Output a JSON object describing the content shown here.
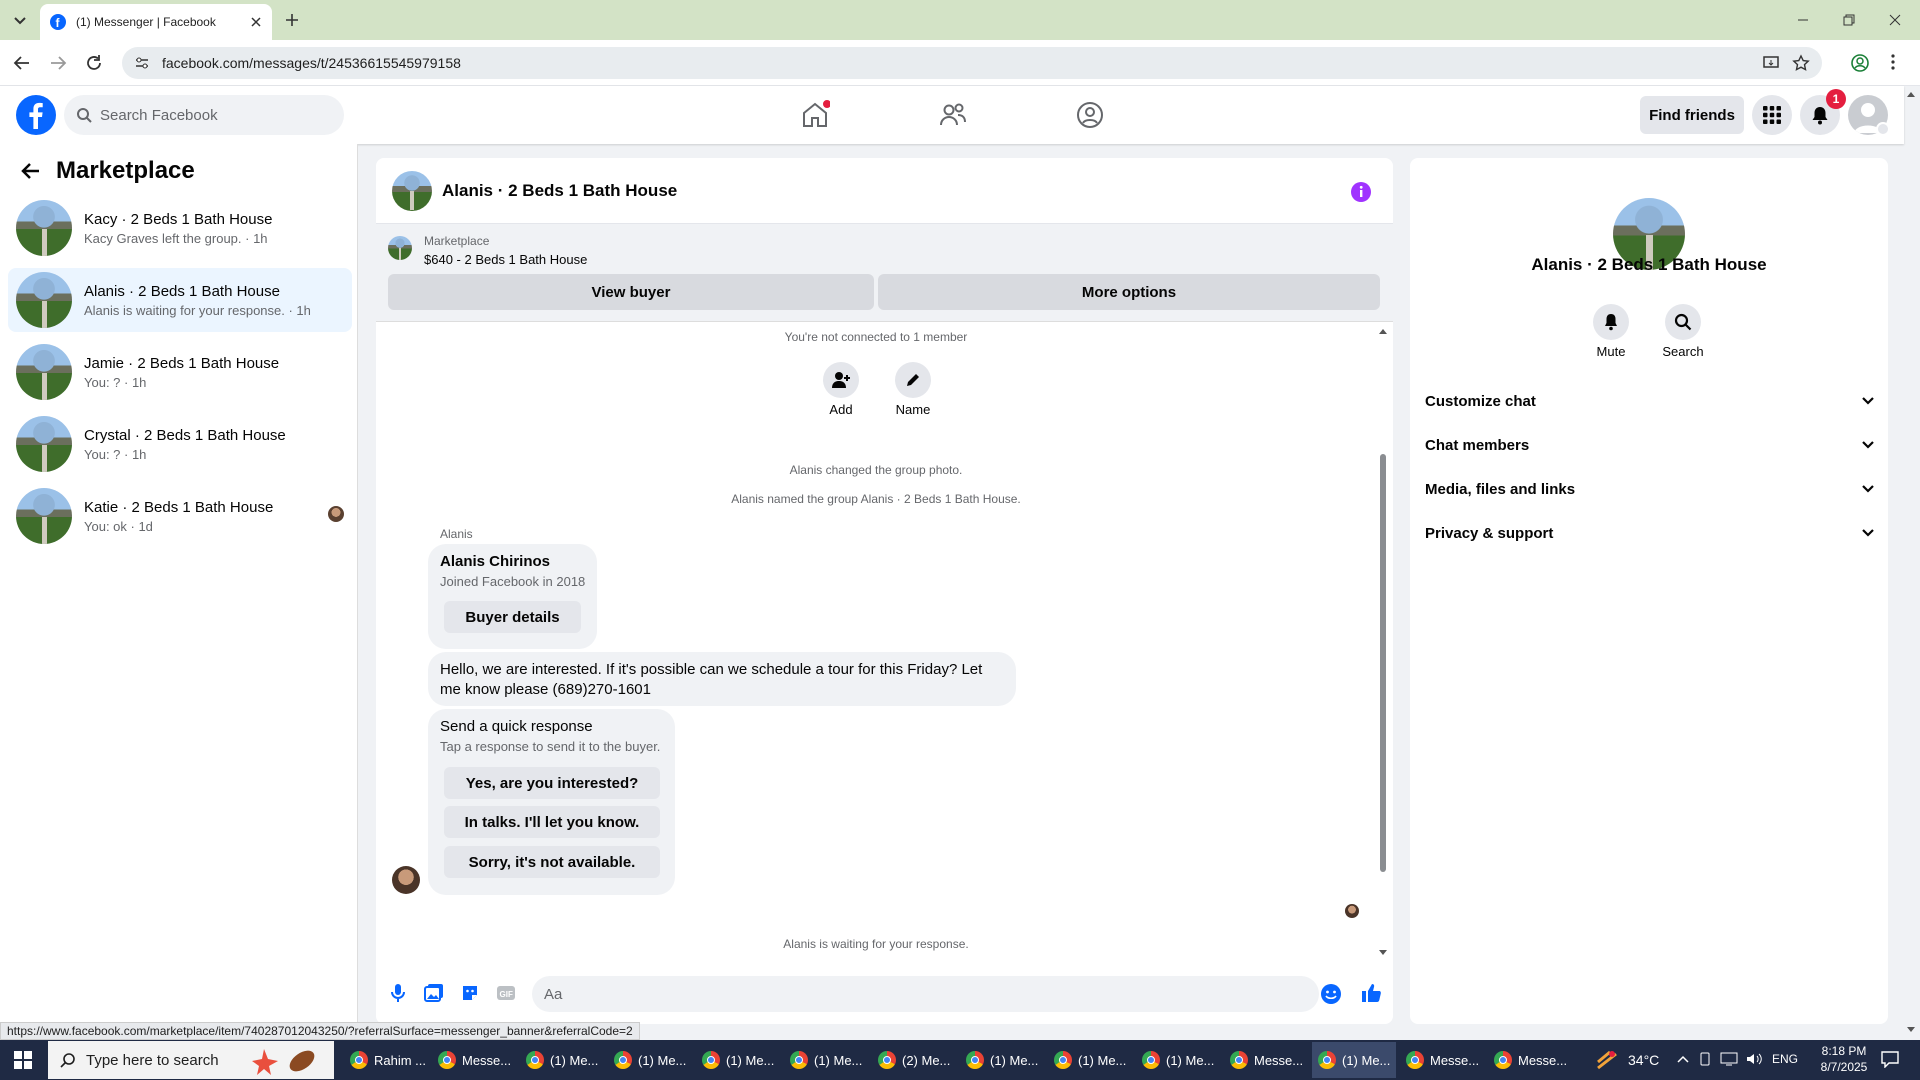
{
  "browser": {
    "tab_title": "(1) Messenger | Facebook",
    "url": "facebook.com/messages/t/24536615545979158",
    "status_url": "https://www.facebook.com/marketplace/item/740287012043250/?referralSurface=messenger_banner&referralCode=2"
  },
  "fb": {
    "search_placeholder": "Search Facebook",
    "find_friends": "Find friends",
    "notif_count": "1",
    "brand_color": "#0866ff"
  },
  "sidebar": {
    "title": "Marketplace",
    "conversations": [
      {
        "name": "Kacy · 2 Beds 1 Bath House",
        "sub": "Kacy Graves left the group. · 1h"
      },
      {
        "name": "Alanis · 2 Beds 1 Bath House",
        "sub": "Alanis is waiting for your response. · 1h"
      },
      {
        "name": "Jamie · 2 Beds 1 Bath House",
        "sub": "You: ? · 1h"
      },
      {
        "name": "Crystal · 2 Beds 1 Bath House",
        "sub": "You: ? · 1h"
      },
      {
        "name": "Katie · 2 Beds 1 Bath House",
        "sub": "You: ok · 1d"
      }
    ]
  },
  "chat": {
    "title": "Alanis · 2 Beds 1 Bath House",
    "banner": {
      "label": "Marketplace",
      "item": "$640 - 2 Beds 1 Bath House",
      "view_buyer": "View buyer",
      "more_options": "More options"
    },
    "not_connected": "You're not connected to 1 member",
    "add_label": "Add",
    "name_label": "Name",
    "event1": "Alanis changed the group photo.",
    "event2": "Alanis named the group Alanis · 2 Beds 1 Bath House.",
    "sender": "Alanis",
    "card": {
      "name": "Alanis Chirinos",
      "joined": "Joined Facebook in 2018",
      "button": "Buyer details"
    },
    "message": "Hello, we are interested. If it's possible can we schedule a tour for this Friday? Let me know please (689)270-1601",
    "quick": {
      "title": "Send a quick response",
      "sub": "Tap a response to send it to the buyer.",
      "options": [
        "Yes, are you interested?",
        "In talks. I'll let you know.",
        "Sorry, it's not available."
      ]
    },
    "waiting": "Alanis is waiting for your response.",
    "composer_placeholder": "Aa"
  },
  "panel": {
    "title": "Alanis · 2 Beds 1 Bath House",
    "mute": "Mute",
    "search": "Search",
    "sections": [
      "Customize chat",
      "Chat members",
      "Media, files and links",
      "Privacy & support"
    ]
  },
  "taskbar": {
    "search": "Type here to search",
    "apps": [
      "Rahim ...",
      "Messe...",
      "(1) Me...",
      "(1) Me...",
      "(1) Me...",
      "(1) Me...",
      "(2) Me...",
      "(1) Me...",
      "(1) Me...",
      "(1) Me...",
      "Messe...",
      "(1) Me...",
      "Messe...",
      "Messe..."
    ],
    "weather": "34°C",
    "lang": "ENG",
    "time": "8:18 PM",
    "date": "8/7/2025"
  }
}
